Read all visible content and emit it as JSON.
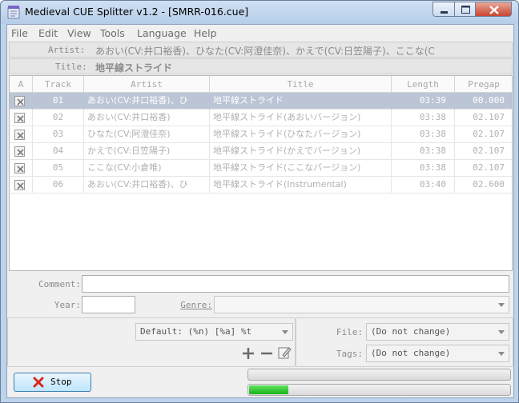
{
  "window": {
    "title": "Medieval CUE Splitter v1.2 - [SMRR-016.cue]"
  },
  "menu": [
    "File",
    "Edit",
    "View",
    "Tools",
    "Language",
    "Help"
  ],
  "album": {
    "artist_label": "Artist:",
    "artist_value": "あおい(CV:井口裕香)、ひなた(CV:阿澄佳奈)、かえで(CV:日笠陽子)、ここな(C",
    "title_label": "Title:",
    "title_value": "地平線ストライド"
  },
  "tracklist": {
    "columns": [
      "A",
      "Track",
      "Artist",
      "Title",
      "Length",
      "Pregap"
    ],
    "rows": [
      {
        "checked": true,
        "track": "01",
        "artist": "あおい(CV:井口裕香)、ひ",
        "title": "地平線ストライド",
        "length": "03:39",
        "pregap": "00.000",
        "selected": true
      },
      {
        "checked": true,
        "track": "02",
        "artist": "あおい(CV:井口裕香)",
        "title": "地平線ストライド(あおいバージョン)",
        "length": "03:38",
        "pregap": "02.107",
        "selected": false
      },
      {
        "checked": true,
        "track": "03",
        "artist": "ひなた(CV:阿澄佳奈)",
        "title": "地平線ストライド(ひなたバージョン)",
        "length": "03:38",
        "pregap": "02.107",
        "selected": false
      },
      {
        "checked": true,
        "track": "04",
        "artist": "かえで(CV:日笠陽子)",
        "title": "地平線ストライド(かえでバージョン)",
        "length": "03:38",
        "pregap": "02.107",
        "selected": false
      },
      {
        "checked": true,
        "track": "05",
        "artist": "ここな(CV:小倉唯)",
        "title": "地平線ストライド(ここなバージョン)",
        "length": "03:38",
        "pregap": "02.107",
        "selected": false
      },
      {
        "checked": true,
        "track": "06",
        "artist": "あおい(CV:井口裕香)、ひ",
        "title": "地平線ストライド(Instrumental)",
        "length": "03:40",
        "pregap": "02.600",
        "selected": false
      }
    ]
  },
  "details": {
    "comment_label": "Comment:",
    "comment_value": "",
    "year_label": "Year:",
    "year_value": "",
    "genre_label": "Genre:",
    "genre_value": ""
  },
  "output": {
    "naming_format": "Default: (%n) [%a] %t",
    "file_label": "File:",
    "file_value": "(Do not change)",
    "tags_label": "Tags:",
    "tags_value": "(Do not change)"
  },
  "actions": {
    "stop_label": "Stop"
  },
  "progress": {
    "total": 0,
    "current": 0.15
  },
  "colors": {
    "selected_row": "#bcc5d6",
    "progress_fill": "#1bb31b",
    "stop_icon": "#d9261c"
  }
}
